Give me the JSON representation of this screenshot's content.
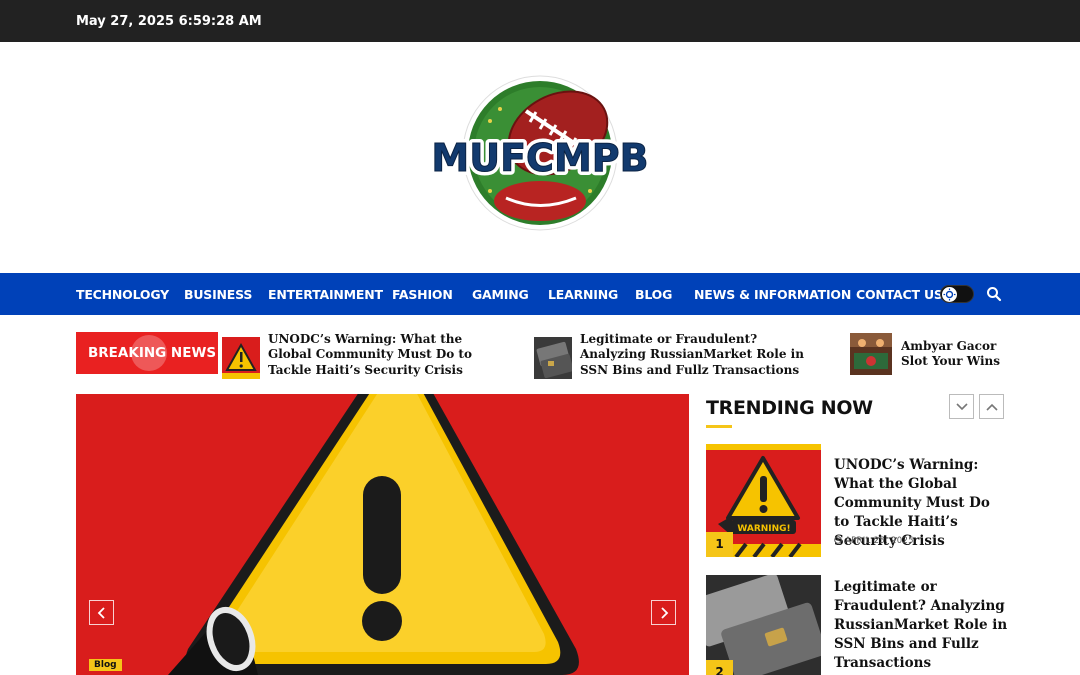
{
  "topbar": {
    "datetime": "May 27, 2025 6:59:28 AM"
  },
  "logo": {
    "text": "MUFCMPB"
  },
  "nav": {
    "items": [
      "TECHNOLOGY",
      "BUSINESS",
      "ENTERTAINMENT",
      "FASHION",
      "GAMING",
      "LEARNING",
      "BLOG",
      "NEWS & INFORMATION",
      "CONTACT US"
    ],
    "toggle_icon": "sun-icon",
    "search_icon": "search-icon"
  },
  "breaking": {
    "label": "BREAKING NEWS",
    "items": [
      {
        "title": "UNODC’s Warning: What the Global Community Must Do to Tackle Haiti’s Security Crisis"
      },
      {
        "title": "Legitimate or Fraudulent? Analyzing RussianMarket Role in SSN Bins and Fullz Transactions"
      },
      {
        "title": "Ambyar Gacor Slot Your Wins with S"
      }
    ]
  },
  "hero": {
    "category": "Blog"
  },
  "trending": {
    "title": "TRENDING NOW",
    "items": [
      {
        "rank": "1",
        "title": "UNODC’s Warning: What the Global Community Must Do to Tackle Haiti’s Security Crisis",
        "date": "APRIL 25, 2025",
        "badge": "WARNING!"
      },
      {
        "rank": "2",
        "title": "Legitimate or Fraudulent? Analyzing RussianMarket Role in SSN Bins and Fullz Transactions"
      }
    ]
  },
  "colors": {
    "nav": "#0041b8",
    "accent": "#f5c518",
    "breaking": "#e92121",
    "topbar": "#222222"
  }
}
